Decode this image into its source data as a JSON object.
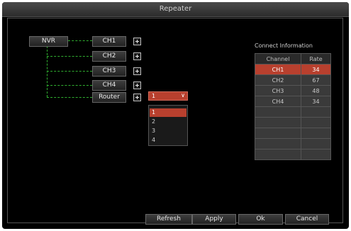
{
  "window": {
    "title": "Repeater"
  },
  "topology": {
    "root_label": "NVR",
    "channels": [
      {
        "label": "CH1"
      },
      {
        "label": "CH2"
      },
      {
        "label": "CH3"
      },
      {
        "label": "CH4"
      }
    ],
    "router_label": "Router",
    "router_select": {
      "value": "1",
      "options": [
        "1",
        "2",
        "3",
        "4"
      ],
      "highlighted": "1"
    }
  },
  "connect_info": {
    "title": "Connect Information",
    "columns": [
      "Channel",
      "Rate"
    ],
    "rows": [
      [
        "CH1",
        "34"
      ],
      [
        "CH2",
        "67"
      ],
      [
        "CH3",
        "48"
      ],
      [
        "CH4",
        "34"
      ],
      [
        "",
        ""
      ],
      [
        "",
        ""
      ],
      [
        "",
        ""
      ],
      [
        "",
        ""
      ],
      [
        "",
        ""
      ]
    ],
    "highlighted_row": 0
  },
  "footer": {
    "refresh": "Refresh",
    "apply": "Apply",
    "ok": "Ok",
    "cancel": "Cancel"
  },
  "colors": {
    "accent": "#b8402e",
    "link_line": "#2fae2f",
    "background": "#000000"
  }
}
